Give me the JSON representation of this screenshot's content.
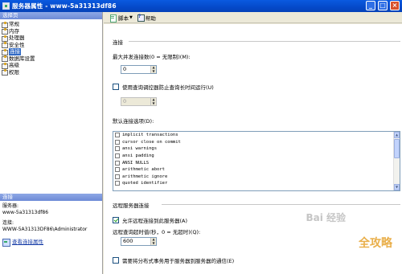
{
  "window": {
    "title": "服务器属性 - www-5a31313df86"
  },
  "left": {
    "header": "选择页",
    "pages": [
      {
        "label": "常规"
      },
      {
        "label": "内存"
      },
      {
        "label": "处理器"
      },
      {
        "label": "安全性"
      },
      {
        "label": "连接",
        "selected": true
      },
      {
        "label": "数据库设置"
      },
      {
        "label": "高级"
      },
      {
        "label": "权限"
      }
    ],
    "connection": {
      "header": "连接",
      "server_label": "服务器:",
      "server_value": "www-5a31313df86",
      "conn_label": "连接:",
      "conn_value": "WWW-5A31313DF86\\Administrator",
      "view_link": "查看连接属性"
    }
  },
  "toolbar": {
    "script_label": "脚本",
    "help_label": "帮助"
  },
  "content": {
    "connections_section": "连接",
    "max_conn_label": "最大并发连接数(0 = 无限制)(M):",
    "max_conn_value": "0",
    "query_gov_label": "使用查询调控器防止查询长时间运行(U)",
    "query_gov_value": "0",
    "default_options_label": "默认连接选项(D):",
    "default_options": [
      "implicit transactions",
      "cursor close on commit",
      "ansi warnings",
      "ansi padding",
      "ANSI NULLS",
      "arithmetic abort",
      "arithmetic ignore",
      "quoted identifier"
    ],
    "remote_section": "远程服务器连接",
    "allow_remote_label": "允许远程连接到此服务器(A)",
    "allow_remote_checked": true,
    "remote_timeout_label": "远程查询超时值(秒，0 = 无超时)(Q):",
    "remote_timeout_value": "600",
    "distributed_label": "需要将分布式事务用于服务器到服务器的通信(E)"
  },
  "watermarks": {
    "baidu": "Bai 经验",
    "brand": "全攻略"
  }
}
